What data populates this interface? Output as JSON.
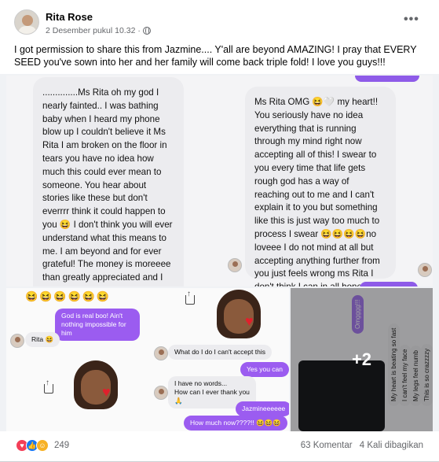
{
  "post": {
    "author": "Rita Rose",
    "date": "2 Desember pukul 10.32",
    "separator": "·",
    "more": "•••",
    "text": "I got permission to share this from Jazmine.... Y'all  are beyond AMAZING! I pray that EVERY SEED you've sown into her and her family will  come back triple fold! I love you guys!!!"
  },
  "image1": {
    "left_message": "..............Ms Rita oh my god I nearly fainted.. I was bathing baby when I heard my phone blow up I couldn't believe it Ms Rita I am broken on the floor in tears you have no idea how much this could ever mean to someone. You hear about stories like these but don't everrrr think it could happen to you 😆 I don't think you will ever understand what this means to me. I am beyond and for ever grateful! The money is moreeee than greatly appreciated and I cannot thank yall enough but the gesture, the thought, the fact that it came from the heart and that y'all really didn't have to do that",
    "right_message": "Ms Rita OMG 😆🤍 my heart!! You seriously have no idea everything that is running through my mind right now accepting all of this! I swear to you every time that life gets rough god has a way of reaching out to me and I can't explain it to you but something like this is just way too much to process I swear 😆😆😆😆no loveee I do not mind at all but accepting anything further from you just feels wrong ms Rita I don't think I can in all honesty this is all already more than enough 😆🙏 🙏🙏🙏"
  },
  "image2": {
    "emoji_row": "😆😆😆😆😆😆",
    "msg1": "God is real boo! Ain't nothing impossible for him",
    "msg2": "Rita 😆",
    "msg3": "What do I do I can't accept this",
    "msg4": "Yes you can",
    "msg5": "I have no words...\nHow can I ever thank you 🙏",
    "msg6": "Jazmineeeeee",
    "msg7": "How much now????!! 😆😆😆"
  },
  "image3": {
    "overlay": "+2",
    "msg_a": "Omgggg!!!",
    "msg_b": "My heart is beating so fast",
    "msg_c": "I can't feel my face",
    "msg_d": "My legs feel numb",
    "msg_e": "This is so crazzzzy"
  },
  "footer": {
    "reaction_count": "249",
    "comments": "63 Komentar",
    "shares": "4 Kali dibagikan"
  }
}
